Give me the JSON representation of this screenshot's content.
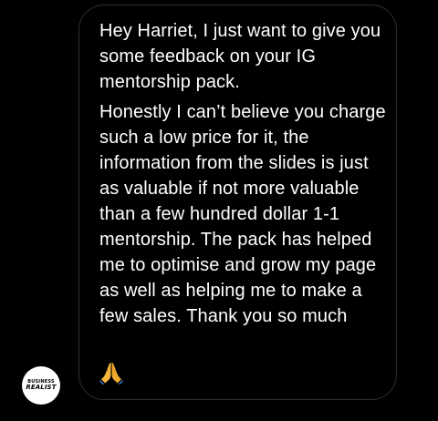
{
  "message": {
    "paragraphs": [
      "Hey Harriet, I just want to give you some feedback on your IG mentorship pack.",
      "Honestly I can’t believe you charge such a low price for it, the information from the slides is just as valuable if not more valuable than a few hundred dollar 1-1 mentorship. The pack has helped me to optimise and grow my page as well as helping me to make a few sales. Thank you so much"
    ],
    "emoji": "folded-hands-emoji"
  },
  "watermark": {
    "line1": "BUSINESS",
    "line2": "REALIST"
  },
  "colors": {
    "background": "#000000",
    "text": "#ffffff",
    "bubble_border": "#2e2e2e",
    "emoji_skin": "#f5b63e"
  }
}
